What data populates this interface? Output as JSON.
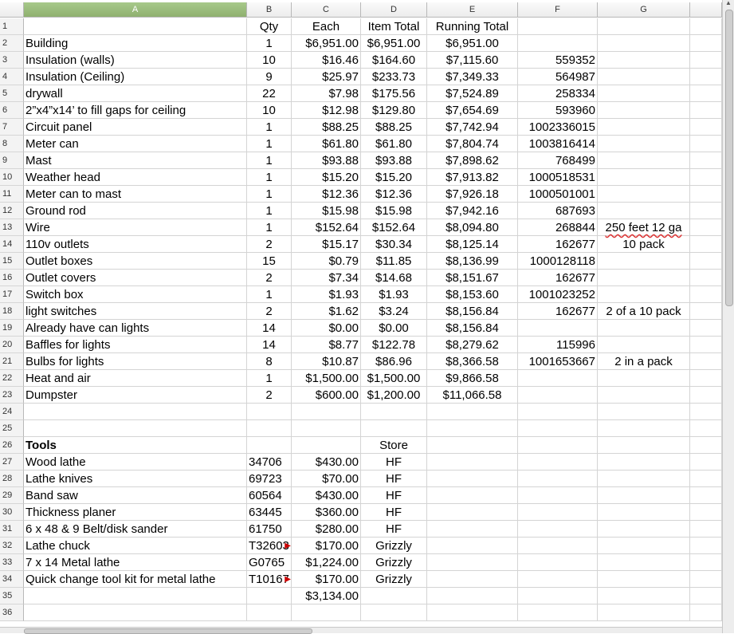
{
  "columns": [
    "A",
    "B",
    "C",
    "D",
    "E",
    "F",
    "G"
  ],
  "selected_column": "A",
  "rows": [
    {
      "n": "1",
      "A": "",
      "B": "Qty",
      "C": "Each",
      "D": "Item Total",
      "E": "Running Total",
      "F": "",
      "G": ""
    },
    {
      "n": "2",
      "A": "Building",
      "B": "1",
      "C": "$6,951.00",
      "D": "$6,951.00",
      "E": "$6,951.00",
      "F": "",
      "G": ""
    },
    {
      "n": "3",
      "A": "Insulation (walls)",
      "B": "10",
      "C": "$16.46",
      "D": "$164.60",
      "E": "$7,115.60",
      "F": "559352",
      "G": ""
    },
    {
      "n": "4",
      "A": "Insulation (Ceiling)",
      "B": "9",
      "C": "$25.97",
      "D": "$233.73",
      "E": "$7,349.33",
      "F": "564987",
      "G": ""
    },
    {
      "n": "5",
      "A": "drywall",
      "B": "22",
      "C": "$7.98",
      "D": "$175.56",
      "E": "$7,524.89",
      "F": "258334",
      "G": ""
    },
    {
      "n": "6",
      "A": "2”x4”x14’ to fill gaps for ceiling",
      "B": "10",
      "C": "$12.98",
      "D": "$129.80",
      "E": "$7,654.69",
      "F": "593960",
      "G": ""
    },
    {
      "n": "7",
      "A": "Circuit panel",
      "B": "1",
      "C": "$88.25",
      "D": "$88.25",
      "E": "$7,742.94",
      "F": "1002336015",
      "G": ""
    },
    {
      "n": "8",
      "A": "Meter can",
      "B": "1",
      "C": "$61.80",
      "D": "$61.80",
      "E": "$7,804.74",
      "F": "1003816414",
      "G": ""
    },
    {
      "n": "9",
      "A": "Mast",
      "B": "1",
      "C": "$93.88",
      "D": "$93.88",
      "E": "$7,898.62",
      "F": "768499",
      "G": ""
    },
    {
      "n": "10",
      "A": "Weather head",
      "B": "1",
      "C": "$15.20",
      "D": "$15.20",
      "E": "$7,913.82",
      "F": "1000518531",
      "G": ""
    },
    {
      "n": "11",
      "A": "Meter can to mast",
      "B": "1",
      "C": "$12.36",
      "D": "$12.36",
      "E": "$7,926.18",
      "F": "1000501001",
      "G": ""
    },
    {
      "n": "12",
      "A": "Ground rod",
      "B": "1",
      "C": "$15.98",
      "D": "$15.98",
      "E": "$7,942.16",
      "F": "687693",
      "G": ""
    },
    {
      "n": "13",
      "A": "Wire",
      "B": "1",
      "C": "$152.64",
      "D": "$152.64",
      "E": "$8,094.80",
      "F": "268844",
      "G": "250 feet 12 ga"
    },
    {
      "n": "14",
      "A": "110v outlets",
      "B": "2",
      "C": "$15.17",
      "D": "$30.34",
      "E": "$8,125.14",
      "F": "162677",
      "G": "10 pack"
    },
    {
      "n": "15",
      "A": "Outlet boxes",
      "B": "15",
      "C": "$0.79",
      "D": "$11.85",
      "E": "$8,136.99",
      "F": "1000128118",
      "G": ""
    },
    {
      "n": "16",
      "A": "Outlet covers",
      "B": "2",
      "C": "$7.34",
      "D": "$14.68",
      "E": "$8,151.67",
      "F": "162677",
      "G": ""
    },
    {
      "n": "17",
      "A": "Switch box",
      "B": "1",
      "C": "$1.93",
      "D": "$1.93",
      "E": "$8,153.60",
      "F": "1001023252",
      "G": ""
    },
    {
      "n": "18",
      "A": "light switches",
      "B": "2",
      "C": "$1.62",
      "D": "$3.24",
      "E": "$8,156.84",
      "F": "162677",
      "G": "2 of a 10 pack"
    },
    {
      "n": "19",
      "A": "Already have can lights",
      "B": "14",
      "C": "$0.00",
      "D": "$0.00",
      "E": "$8,156.84",
      "F": "",
      "G": ""
    },
    {
      "n": "20",
      "A": "Baffles for lights",
      "B": "14",
      "C": "$8.77",
      "D": "$122.78",
      "E": "$8,279.62",
      "F": "115996",
      "G": ""
    },
    {
      "n": "21",
      "A": "Bulbs for lights",
      "B": "8",
      "C": "$10.87",
      "D": "$86.96",
      "E": "$8,366.58",
      "F": "1001653667",
      "G": "2 in a pack"
    },
    {
      "n": "22",
      "A": "Heat and air",
      "B": "1",
      "C": "$1,500.00",
      "D": "$1,500.00",
      "E": "$9,866.58",
      "F": "",
      "G": ""
    },
    {
      "n": "23",
      "A": "Dumpster",
      "B": "2",
      "C": "$600.00",
      "D": "$1,200.00",
      "E": "$11,066.58",
      "F": "",
      "G": ""
    },
    {
      "n": "24",
      "A": "",
      "B": "",
      "C": "",
      "D": "",
      "E": "",
      "F": "",
      "G": ""
    },
    {
      "n": "25",
      "A": "",
      "B": "",
      "C": "",
      "D": "",
      "E": "",
      "F": "",
      "G": ""
    },
    {
      "n": "26",
      "A": "Tools",
      "B": "",
      "C": "",
      "D": "Store",
      "E": "",
      "F": "",
      "G": ""
    },
    {
      "n": "27",
      "A": "Wood lathe",
      "B": "34706",
      "C": "$430.00",
      "D": "HF",
      "E": "",
      "F": "",
      "G": ""
    },
    {
      "n": "28",
      "A": "Lathe knives",
      "B": "69723",
      "C": "$70.00",
      "D": "HF",
      "E": "",
      "F": "",
      "G": ""
    },
    {
      "n": "29",
      "A": "Band saw",
      "B": "60564",
      "C": "$430.00",
      "D": "HF",
      "E": "",
      "F": "",
      "G": ""
    },
    {
      "n": "30",
      "A": "Thickness planer",
      "B": "63445",
      "C": "$360.00",
      "D": "HF",
      "E": "",
      "F": "",
      "G": ""
    },
    {
      "n": "31",
      "A": "6 x 48 & 9 Belt/disk sander",
      "B": "61750",
      "C": "$280.00",
      "D": "HF",
      "E": "",
      "F": "",
      "G": ""
    },
    {
      "n": "32",
      "A": "Lathe chuck",
      "B": "T32603",
      "C": "$170.00",
      "D": "Grizzly",
      "E": "",
      "F": "",
      "G": ""
    },
    {
      "n": "33",
      "A": "7 x 14 Metal lathe",
      "B": "G0765",
      "C": "$1,224.00",
      "D": "Grizzly",
      "E": "",
      "F": "",
      "G": ""
    },
    {
      "n": "34",
      "A": "Quick change tool kit for metal lathe",
      "B": "T10167",
      "C": "$170.00",
      "D": "Grizzly",
      "E": "",
      "F": "",
      "G": ""
    },
    {
      "n": "35",
      "A": "",
      "B": "",
      "C": "$3,134.00",
      "D": "",
      "E": "",
      "F": "",
      "G": ""
    },
    {
      "n": "36",
      "A": "",
      "B": "",
      "C": "",
      "D": "",
      "E": "",
      "F": "",
      "G": ""
    }
  ]
}
